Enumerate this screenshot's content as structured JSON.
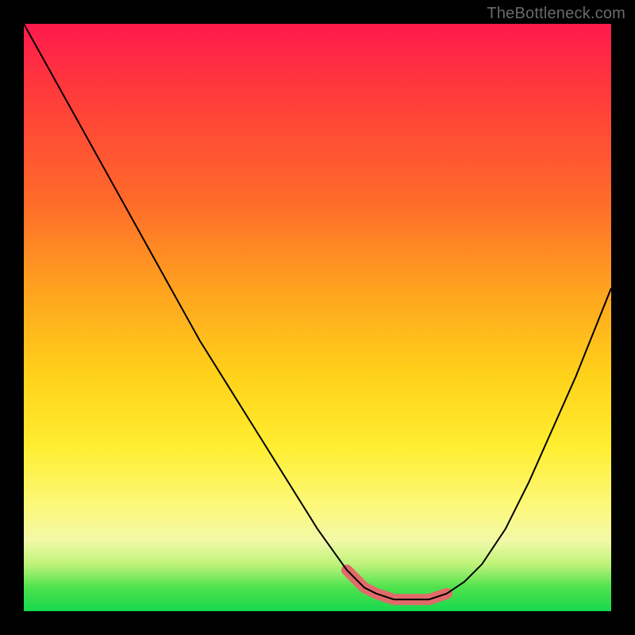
{
  "watermark": "TheBottleneck.com",
  "chart_data": {
    "type": "line",
    "title": "",
    "xlabel": "",
    "ylabel": "",
    "xlim": [
      0,
      100
    ],
    "ylim": [
      0,
      100
    ],
    "grid": false,
    "legend": false,
    "series": [
      {
        "name": "bottleneck-curve",
        "x": [
          0,
          5,
          10,
          15,
          20,
          25,
          30,
          35,
          40,
          45,
          50,
          55,
          58,
          60,
          63,
          66,
          69,
          72,
          75,
          78,
          82,
          86,
          90,
          94,
          100
        ],
        "values": [
          100,
          91,
          82,
          73,
          64,
          55,
          46,
          38,
          30,
          22,
          14,
          7,
          4,
          3,
          2,
          2,
          2,
          3,
          5,
          8,
          14,
          22,
          31,
          40,
          55
        ]
      }
    ],
    "annotations": [
      {
        "name": "valley-floor-highlight",
        "kind": "overlay-segment",
        "x_range": [
          55,
          72
        ],
        "color": "#e26a6a"
      }
    ],
    "background": {
      "type": "vertical-gradient",
      "top_color": "#ff1a4d",
      "bottom_color": "#17d84d"
    }
  }
}
